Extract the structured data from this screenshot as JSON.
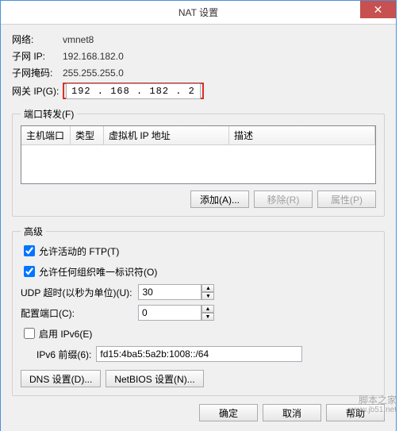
{
  "title": "NAT 设置",
  "info": {
    "network_label": "网络:",
    "network_value": "vmnet8",
    "subnet_label": "子网 IP:",
    "subnet_value": "192.168.182.0",
    "mask_label": "子网掩码:",
    "mask_value": "255.255.255.0",
    "gateway_label": "网关 IP(G):",
    "gateway_value": "192 . 168 . 182 .   2"
  },
  "port_forward": {
    "legend": "端口转发(F)",
    "cols": {
      "host_port": "主机端口",
      "type": "类型",
      "vm_ip": "虚拟机 IP 地址",
      "desc": "描述"
    },
    "add": "添加(A)...",
    "remove": "移除(R)",
    "props": "属性(P)"
  },
  "advanced": {
    "legend": "高级",
    "allow_ftp": "允许活动的 FTP(T)",
    "allow_oui": "允许任何组织唯一标识符(O)",
    "udp_timeout_label": "UDP 超时(以秒为单位)(U):",
    "udp_timeout_value": "30",
    "config_port_label": "配置端口(C):",
    "config_port_value": "0",
    "enable_ipv6": "启用 IPv6(E)",
    "ipv6_prefix_label": "IPv6 前缀(6):",
    "ipv6_prefix_value": "fd15:4ba5:5a2b:1008::/64",
    "dns_btn": "DNS 设置(D)...",
    "netbios_btn": "NetBIOS 设置(N)..."
  },
  "buttons": {
    "ok": "确定",
    "cancel": "取消",
    "help": "帮助"
  },
  "watermark": {
    "main": "脚本之家",
    "sub": "www.jb51.net"
  }
}
